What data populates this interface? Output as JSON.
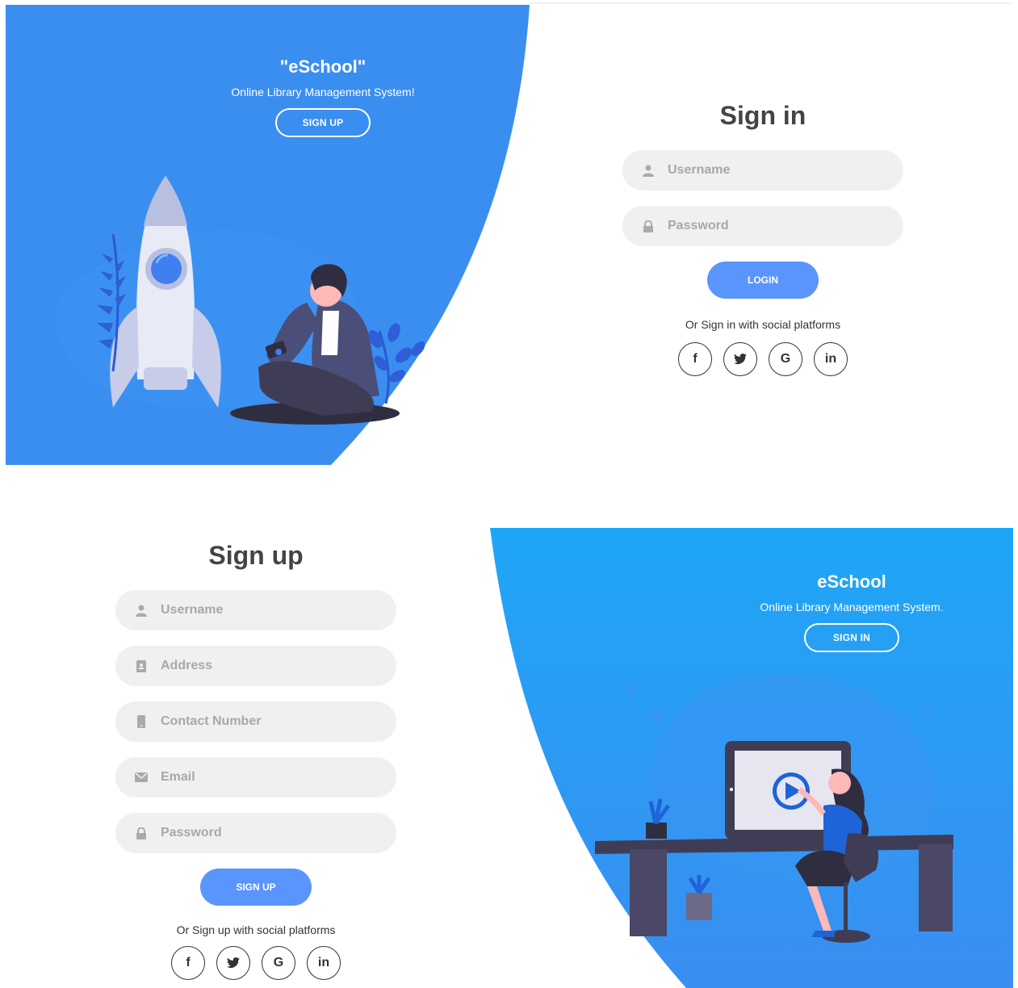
{
  "signin_panel": {
    "hero": {
      "title": "\"eSchool\"",
      "subtitle": "Online Library Management System!",
      "button": "SIGN UP"
    },
    "form": {
      "title": "Sign in",
      "username_placeholder": "Username",
      "password_placeholder": "Password",
      "submit": "LOGIN",
      "social_text": "Or Sign in with social platforms"
    }
  },
  "signup_panel": {
    "hero": {
      "title": "eSchool",
      "subtitle": "Online Library Management System.",
      "button": "SIGN IN"
    },
    "form": {
      "title": "Sign up",
      "username_placeholder": "Username",
      "address_placeholder": "Address",
      "contact_placeholder": "Contact Number",
      "email_placeholder": "Email",
      "password_placeholder": "Password",
      "submit": "SIGN UP",
      "social_text": "Or Sign up with social platforms"
    }
  },
  "social": {
    "facebook": "f",
    "twitter": "t",
    "google": "G",
    "linkedin": "in"
  },
  "colors": {
    "hero_blue": "#3a8ef0",
    "hero_blue_alt": "#24a3f6",
    "primary": "#5995fd",
    "field_bg": "#f0f0f0"
  }
}
